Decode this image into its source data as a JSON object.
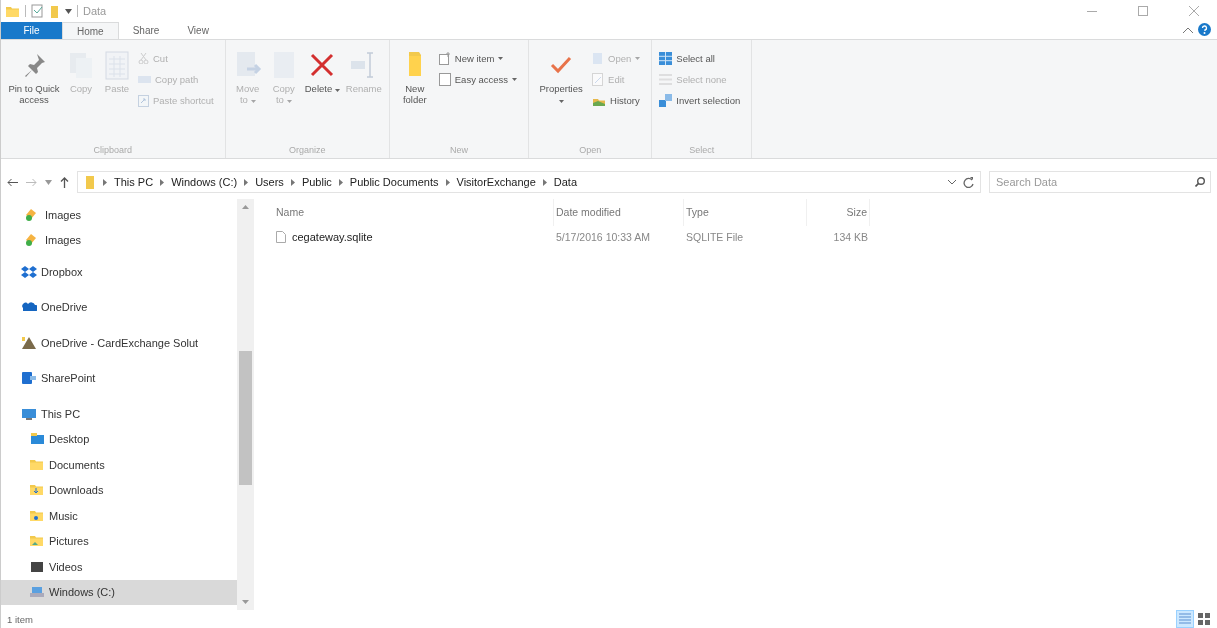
{
  "window": {
    "title": "Data"
  },
  "ribbon_tabs": [
    {
      "label": "File",
      "kind": "file",
      "selected": false
    },
    {
      "label": "Home",
      "kind": "tab",
      "selected": true
    },
    {
      "label": "Share",
      "kind": "tab",
      "selected": false
    },
    {
      "label": "View",
      "kind": "tab",
      "selected": false
    }
  ],
  "ribbon_groups": [
    {
      "label": "Clipboard",
      "items": [
        {
          "kind": "large",
          "label": "Pin to Quick access",
          "menu": false,
          "disabled": false
        },
        {
          "kind": "large",
          "label": "Copy",
          "menu": false,
          "disabled": true
        },
        {
          "kind": "large",
          "label": "Paste",
          "menu": false,
          "disabled": true
        },
        {
          "kind": "small",
          "label": "Cut",
          "menu": false,
          "disabled": true
        },
        {
          "kind": "small",
          "label": "Copy path",
          "menu": false,
          "disabled": true
        },
        {
          "kind": "small",
          "label": "Paste shortcut",
          "menu": false,
          "disabled": true
        }
      ]
    },
    {
      "label": "Organize",
      "items": [
        {
          "kind": "large",
          "label": "Move to",
          "menu": true,
          "disabled": true
        },
        {
          "kind": "large",
          "label": "Copy to",
          "menu": true,
          "disabled": true
        },
        {
          "kind": "large",
          "label": "Delete",
          "menu": true,
          "disabled": false
        },
        {
          "kind": "large",
          "label": "Rename",
          "menu": false,
          "disabled": true
        }
      ]
    },
    {
      "label": "New",
      "items": [
        {
          "kind": "large",
          "label": "New folder",
          "menu": false,
          "disabled": false
        },
        {
          "kind": "small",
          "label": "New item",
          "menu": true,
          "disabled": false
        },
        {
          "kind": "small",
          "label": "Easy access",
          "menu": true,
          "disabled": false
        }
      ]
    },
    {
      "label": "Open",
      "items": [
        {
          "kind": "large",
          "label": "Properties",
          "menu": true,
          "disabled": false
        },
        {
          "kind": "small",
          "label": "Open",
          "menu": true,
          "disabled": true
        },
        {
          "kind": "small",
          "label": "Edit",
          "menu": false,
          "disabled": true
        },
        {
          "kind": "small",
          "label": "History",
          "menu": false,
          "disabled": false
        }
      ]
    },
    {
      "label": "Select",
      "items": [
        {
          "kind": "small",
          "label": "Select all",
          "menu": false,
          "disabled": false
        },
        {
          "kind": "small",
          "label": "Select none",
          "menu": false,
          "disabled": true
        },
        {
          "kind": "small",
          "label": "Invert selection",
          "menu": false,
          "disabled": false
        }
      ]
    }
  ],
  "address_bar": {
    "breadcrumbs": [
      "This PC",
      "Windows (C:)",
      "Users",
      "Public",
      "Public Documents",
      "VisitorExchange",
      "Data"
    ]
  },
  "search": {
    "placeholder": "Search Data"
  },
  "navigation_pane": {
    "items": [
      {
        "label": "Images",
        "kind": "library",
        "selected": false
      },
      {
        "label": "Images",
        "kind": "library",
        "selected": false
      },
      {
        "label": "Dropbox",
        "kind": "dropbox",
        "selected": false
      },
      {
        "label": "OneDrive",
        "kind": "onedrive",
        "selected": false
      },
      {
        "label": "OneDrive - CardExchange Solut",
        "kind": "business",
        "selected": false
      },
      {
        "label": "SharePoint",
        "kind": "sharepoint",
        "selected": false
      },
      {
        "label": "This PC",
        "kind": "pc",
        "selected": false,
        "children": [
          {
            "label": "Desktop",
            "kind": "desktop",
            "selected": false
          },
          {
            "label": "Documents",
            "kind": "documents",
            "selected": false
          },
          {
            "label": "Downloads",
            "kind": "downloads",
            "selected": false
          },
          {
            "label": "Music",
            "kind": "music",
            "selected": false
          },
          {
            "label": "Pictures",
            "kind": "pictures",
            "selected": false
          },
          {
            "label": "Videos",
            "kind": "videos",
            "selected": false
          },
          {
            "label": "Windows (C:)",
            "kind": "drive",
            "selected": true
          }
        ]
      }
    ]
  },
  "file_list": {
    "columns": [
      "Name",
      "Date modified",
      "Type",
      "Size"
    ],
    "rows": [
      {
        "name": "cegateway.sqlite",
        "date_modified": "5/17/2016 10:33 AM",
        "type": "SQLITE File",
        "size": "134 KB",
        "selected": false
      }
    ]
  },
  "status_bar": {
    "text": "1 item",
    "view_buttons": [
      {
        "kind": "details",
        "selected": true
      },
      {
        "kind": "large_icons",
        "selected": false
      }
    ]
  }
}
